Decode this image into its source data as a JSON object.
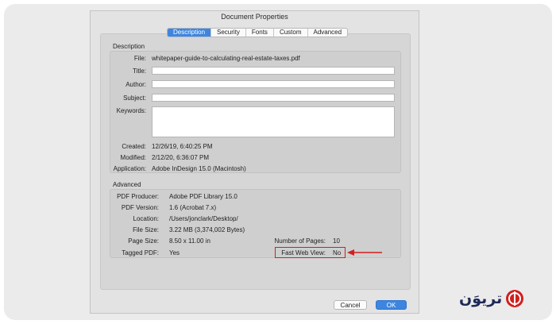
{
  "dialog": {
    "title": "Document Properties",
    "tabs": [
      {
        "label": "Description",
        "active": true
      },
      {
        "label": "Security",
        "active": false
      },
      {
        "label": "Fonts",
        "active": false
      },
      {
        "label": "Custom",
        "active": false
      },
      {
        "label": "Advanced",
        "active": false
      }
    ]
  },
  "description": {
    "section_label": "Description",
    "file_label": "File:",
    "file_value": "whitepaper-guide-to-calculating-real-estate-taxes.pdf",
    "title_label": "Title:",
    "title_value": "",
    "author_label": "Author:",
    "author_value": "",
    "subject_label": "Subject:",
    "subject_value": "",
    "keywords_label": "Keywords:",
    "keywords_value": "",
    "created_label": "Created:",
    "created_value": "12/26/19, 6:40:25 PM",
    "modified_label": "Modified:",
    "modified_value": "2/12/20, 6:36:07 PM",
    "application_label": "Application:",
    "application_value": "Adobe InDesign 15.0 (Macintosh)"
  },
  "advanced": {
    "section_label": "Advanced",
    "producer_label": "PDF Producer:",
    "producer_value": "Adobe PDF Library 15.0",
    "version_label": "PDF Version:",
    "version_value": "1.6 (Acrobat 7.x)",
    "location_label": "Location:",
    "location_value": "/Users/jonclark/Desktop/",
    "filesize_label": "File Size:",
    "filesize_value": "3.22 MB (3,374,002 Bytes)",
    "pagesize_label": "Page Size:",
    "pagesize_value": "8.50 x 11.00 in",
    "pages_label": "Number of Pages:",
    "pages_value": "10",
    "tagged_label": "Tagged PDF:",
    "tagged_value": "Yes",
    "fastweb_label": "Fast Web View:",
    "fastweb_value": "No"
  },
  "buttons": {
    "cancel_label": "Cancel",
    "ok_label": "OK"
  },
  "branding": {
    "logo_text": "تریوَن",
    "annotation_color": "#d21f1f",
    "accent_color": "#3d86e0"
  }
}
